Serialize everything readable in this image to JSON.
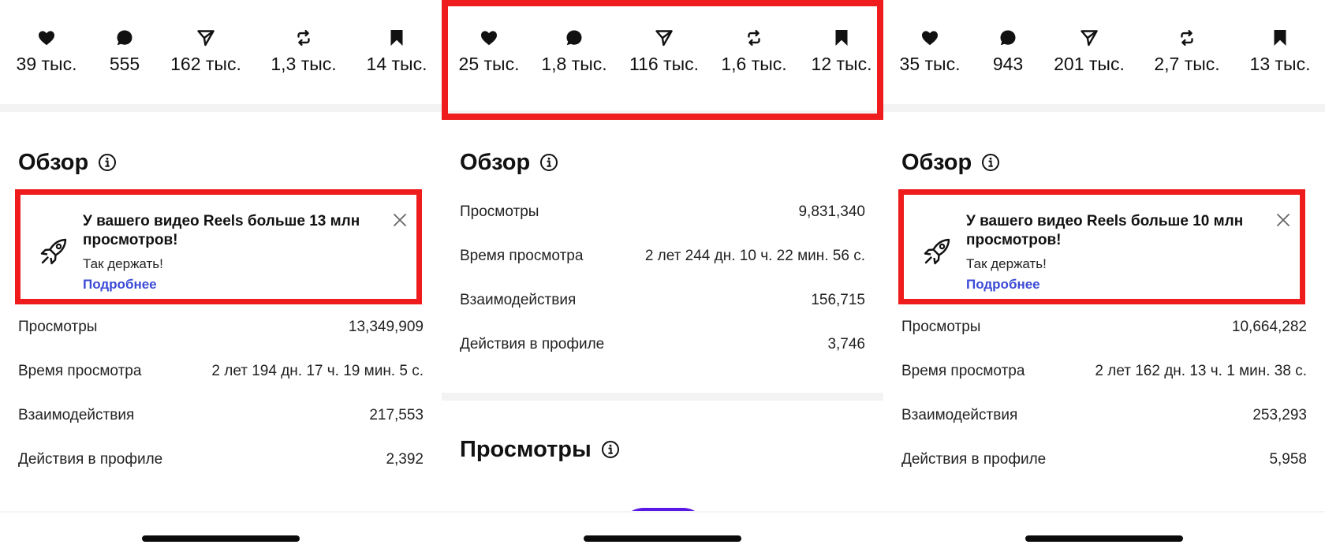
{
  "colors": {
    "highlight_red": "#ee1c1c",
    "link_blue": "#3b4ad6",
    "chart_purple": "#5a18e6",
    "text": "#111111"
  },
  "icons": {
    "stats": [
      "heart-icon",
      "comment-icon",
      "share-icon",
      "repost-icon",
      "bookmark-icon"
    ],
    "section_info": "info-icon",
    "banner": "rocket-icon",
    "banner_close": "close-icon"
  },
  "panels": [
    {
      "stats": [
        "39 тыс.",
        "555",
        "162 тыс.",
        "1,3 тыс.",
        "14 тыс."
      ],
      "overview_title": "Обзор",
      "banner": {
        "title": "У вашего видео Reels больше 13 млн просмотров!",
        "subtitle": "Так держать!",
        "link": "Подробнее"
      },
      "metrics": [
        {
          "label": "Просмотры",
          "value": "13,349,909"
        },
        {
          "label": "Время просмотра",
          "value": "2 лет 194 дн. 17 ч. 19 мин. 5 с."
        },
        {
          "label": "Взаимодействия",
          "value": "217,553"
        },
        {
          "label": "Действия в профиле",
          "value": "2,392"
        }
      ]
    },
    {
      "stats": [
        "25 тыс.",
        "1,8 тыс.",
        "116 тыс.",
        "1,6 тыс.",
        "12 тыс."
      ],
      "overview_title": "Обзор",
      "metrics": [
        {
          "label": "Просмотры",
          "value": "9,831,340"
        },
        {
          "label": "Время просмотра",
          "value": "2 лет 244 дн. 10 ч. 22 мин. 56 с."
        },
        {
          "label": "Взаимодействия",
          "value": "156,715"
        },
        {
          "label": "Действия в профиле",
          "value": "3,746"
        }
      ],
      "views_title": "Просмотры"
    },
    {
      "stats": [
        "35 тыс.",
        "943",
        "201 тыс.",
        "2,7 тыс.",
        "13 тыс."
      ],
      "overview_title": "Обзор",
      "banner": {
        "title": "У вашего видео Reels больше 10 млн просмотров!",
        "subtitle": "Так держать!",
        "link": "Подробнее"
      },
      "metrics": [
        {
          "label": "Просмотры",
          "value": "10,664,282"
        },
        {
          "label": "Время просмотра",
          "value": "2 лет 162 дн. 13 ч. 1 мин. 38 с."
        },
        {
          "label": "Взаимодействия",
          "value": "253,293"
        },
        {
          "label": "Действия в профиле",
          "value": "5,958"
        }
      ]
    }
  ]
}
